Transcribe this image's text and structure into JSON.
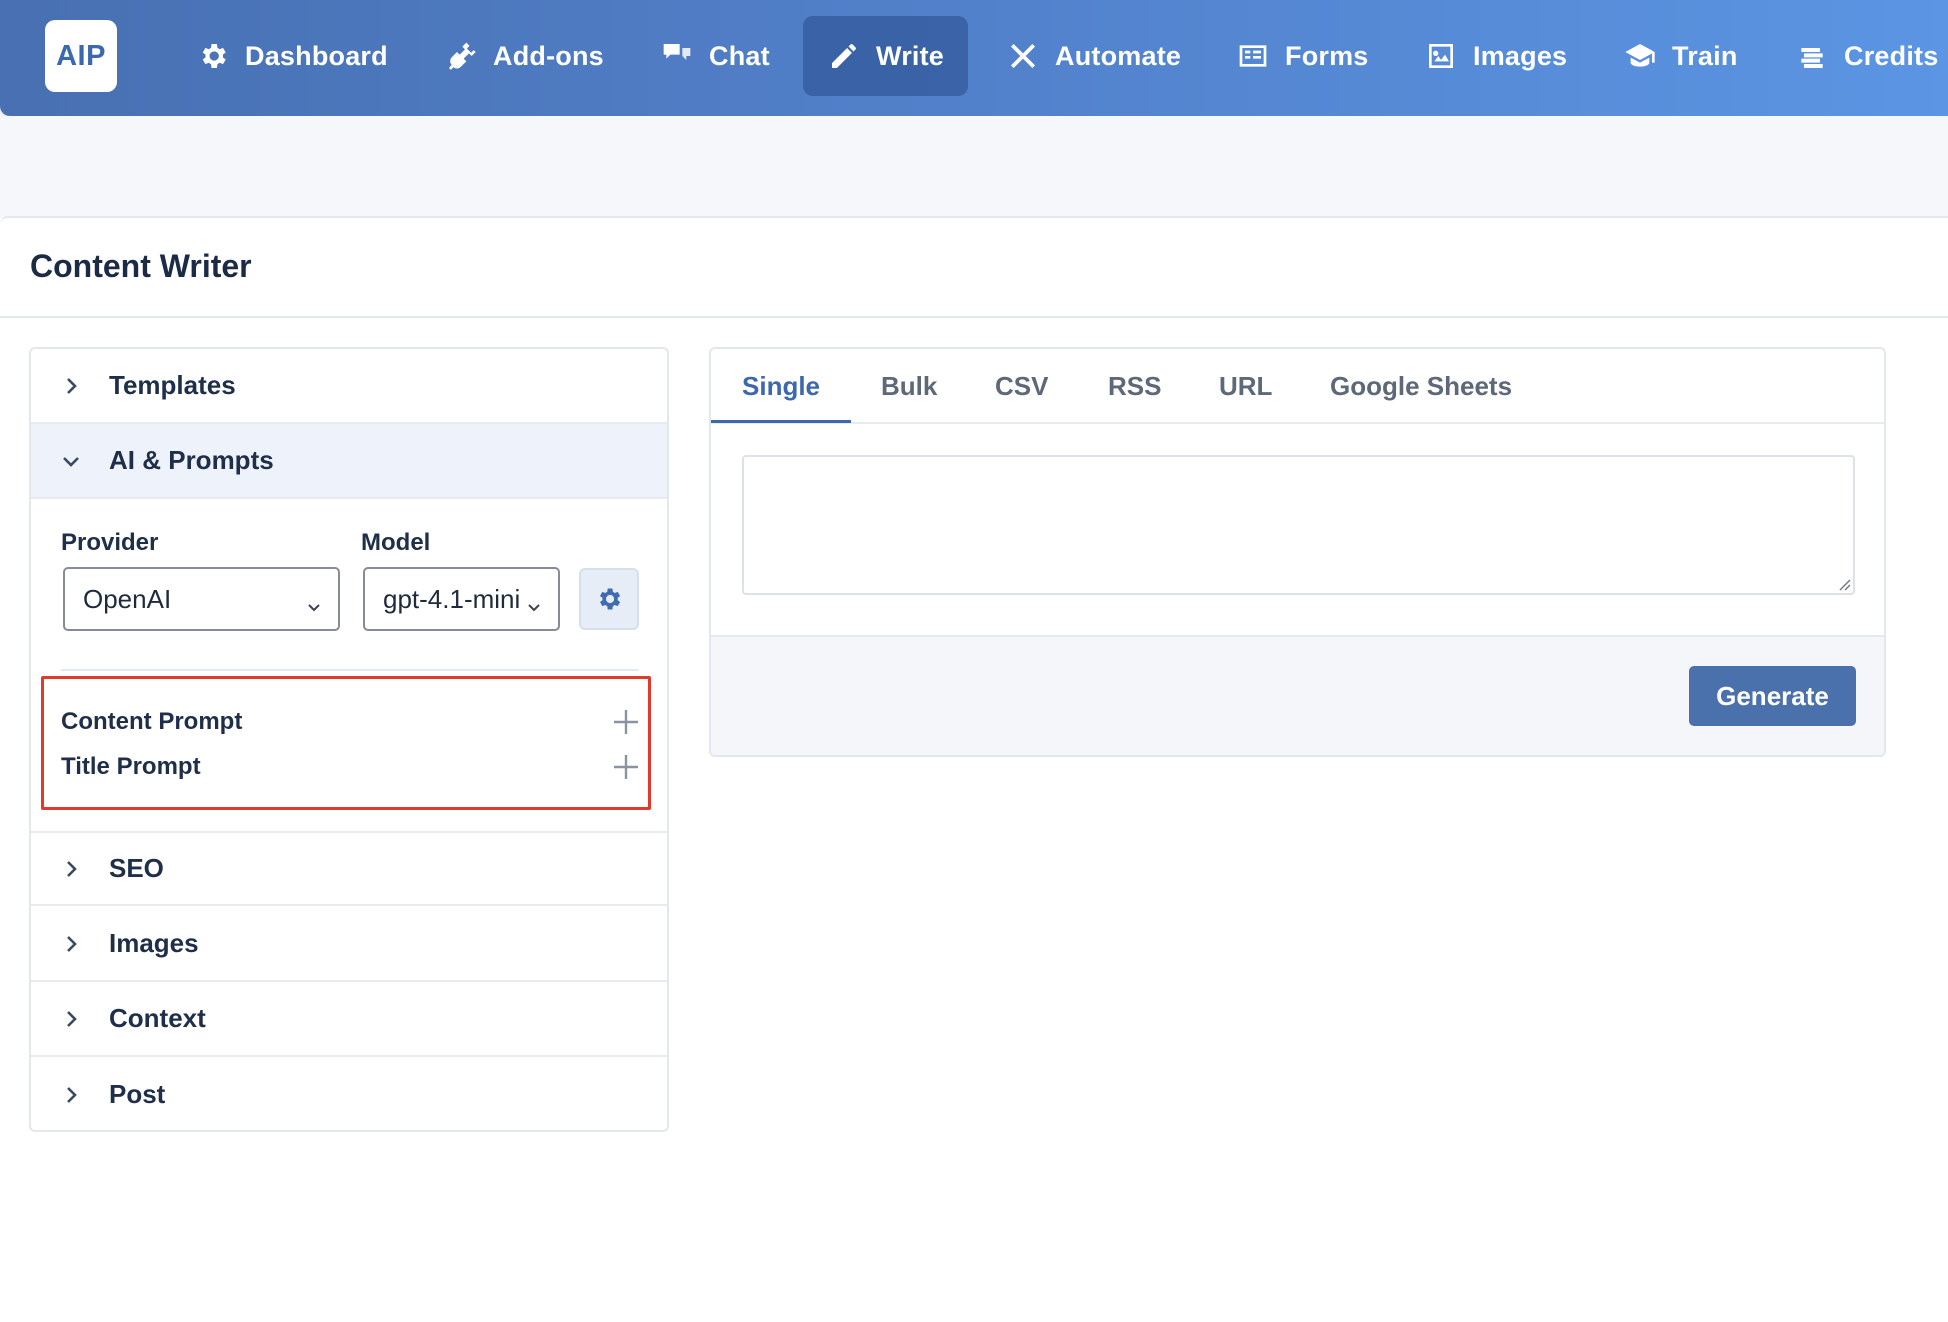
{
  "app": {
    "logo_text": "AIP"
  },
  "nav": {
    "items": [
      {
        "label": "Dashboard",
        "icon": "gear-icon"
      },
      {
        "label": "Add-ons",
        "icon": "plug-icon"
      },
      {
        "label": "Chat",
        "icon": "chat-bubbles-icon"
      },
      {
        "label": "Write",
        "icon": "pencil-icon",
        "active": true
      },
      {
        "label": "Automate",
        "icon": "tools-icon"
      },
      {
        "label": "Forms",
        "icon": "form-icon"
      },
      {
        "label": "Images",
        "icon": "image-icon"
      },
      {
        "label": "Train",
        "icon": "graduation-cap-icon"
      },
      {
        "label": "Credits",
        "icon": "coins-icon"
      }
    ]
  },
  "page": {
    "title": "Content Writer"
  },
  "accordion": {
    "sections": [
      {
        "label": "Templates",
        "expanded": false
      },
      {
        "label": "AI & Prompts",
        "expanded": true
      },
      {
        "label": "SEO",
        "expanded": false
      },
      {
        "label": "Images",
        "expanded": false
      },
      {
        "label": "Context",
        "expanded": false
      },
      {
        "label": "Post",
        "expanded": false
      }
    ],
    "ai": {
      "provider_label": "Provider",
      "provider_value": "OpenAI",
      "model_label": "Model",
      "model_value": "gpt-4.1-mini",
      "prompts": [
        {
          "label": "Content Prompt"
        },
        {
          "label": "Title Prompt"
        }
      ]
    }
  },
  "writer": {
    "tabs": [
      {
        "label": "Single",
        "active": true
      },
      {
        "label": "Bulk"
      },
      {
        "label": "CSV"
      },
      {
        "label": "RSS"
      },
      {
        "label": "URL"
      },
      {
        "label": "Google Sheets"
      }
    ],
    "input_value": "",
    "generate_label": "Generate"
  },
  "colors": {
    "nav_gradient_start": "#4870b2",
    "nav_gradient_end": "#5b95e3",
    "accent": "#3d68ad",
    "button": "#4a71ac",
    "highlight_box": "#e03a2f"
  }
}
